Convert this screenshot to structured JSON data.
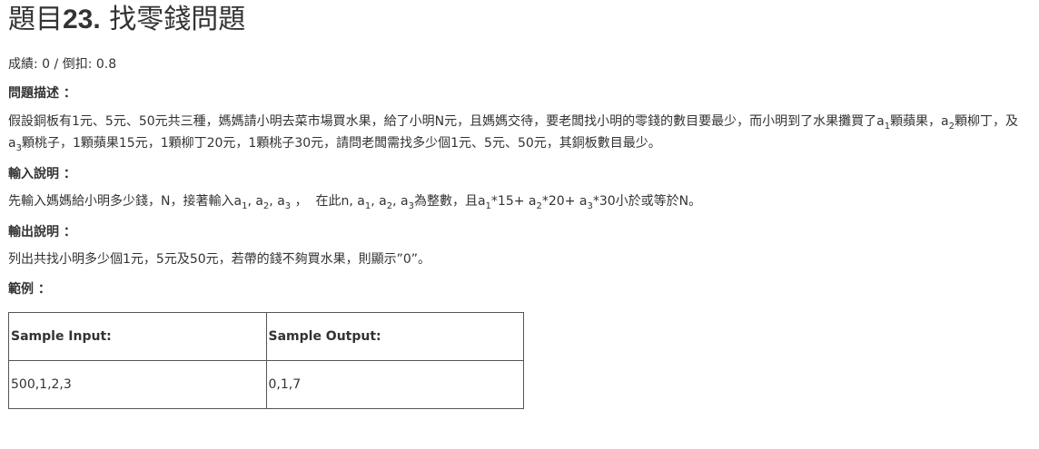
{
  "problem": {
    "title_prefix": "題目",
    "title_number": "23.",
    "title_name": "找零錢問題"
  },
  "score": {
    "text": "成績: 0 / 倒扣: 0.8"
  },
  "sections": {
    "description": {
      "heading": "問題描述 ：",
      "text_1": "假設銅板有1元、5元、50元共三種，媽媽請小明去菜市場買水果，給了小明N元，且媽媽交待，要老闆找小明的零錢的數目要最少，而小明到了水果攤買了a",
      "sub_1": "1",
      "text_2": "顆蘋果，a",
      "sub_2": "2",
      "text_3": "顆柳丁，及a",
      "sub_3": "3",
      "text_4": "顆桃子，1顆蘋果15元，1顆柳丁20元，1顆桃子30元，請問老闆需找多少個1元、5元、50元，其銅板數目最少。"
    },
    "input": {
      "heading": "輸入說明 ：",
      "text_1": "先輸入媽媽給小明多少錢，N，接著輸入a",
      "sub_1": "1",
      "text_2": ", a",
      "sub_2": "2",
      "text_3": ", a",
      "sub_3": "3",
      "text_4": " ，  在此n, a",
      "sub_4": "1",
      "text_5": ", a",
      "sub_5": "2",
      "text_6": ", a",
      "sub_6": "3",
      "text_7": "為整數，且a",
      "sub_7": "1",
      "text_8": "*15+ a",
      "sub_8": "2",
      "text_9": "*20+ a",
      "sub_9": "3",
      "text_10": "*30小於或等於N。"
    },
    "output": {
      "heading": "輸出說明 ：",
      "text": "列出共找小明多少個1元，5元及50元，若帶的錢不夠買水果，則顯示”0”。"
    },
    "example": {
      "heading": "範例 ："
    }
  },
  "sample_table": {
    "headers": [
      "Sample Input:",
      "Sample Output:"
    ],
    "rows": [
      [
        "500,1,2,3",
        "0,1,7"
      ]
    ]
  }
}
